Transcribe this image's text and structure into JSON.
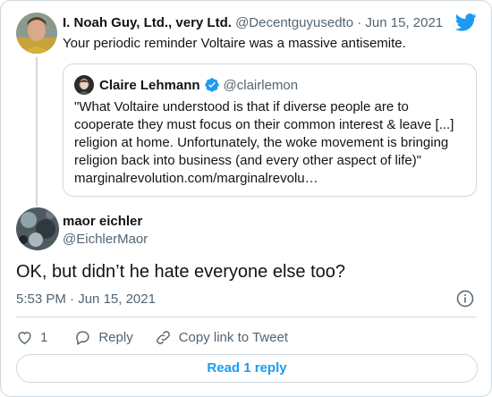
{
  "parent_tweet": {
    "name": "I. Noah Guy, Ltd., very Ltd.",
    "handle": "@Decentguyusedto",
    "separator": "·",
    "date": "Jun 15, 2021",
    "text": "Your periodic reminder Voltaire was a massive antisemite."
  },
  "quoted_tweet": {
    "name": "Claire Lehmann",
    "handle": "@clairlemon",
    "verified": true,
    "lines": [
      "\"What Voltaire understood is that if diverse people are to",
      "cooperate they must focus on their common interest &  leave [...]",
      "religion at home. Unfortunately, the woke movement is bringing",
      "religion back into business (and every other aspect of life)\"",
      "marginalrevolution.com/marginalrevolu…"
    ]
  },
  "main_tweet": {
    "name": "maor eichler",
    "handle": "@EichlerMaor",
    "text": "OK, but didn’t he hate everyone else too?",
    "time": "5:53 PM",
    "separator": "·",
    "date": "Jun 15, 2021"
  },
  "actions": {
    "like_count": "1",
    "reply_label": "Reply",
    "copy_link_label": "Copy link to Tweet"
  },
  "read_replies_label": "Read 1 reply",
  "colors": {
    "accent": "#1d9bf0",
    "text": "#0f1419",
    "muted": "#536471",
    "border": "#cfd9de"
  },
  "icons": [
    "twitter-bird-icon",
    "verified-badge-icon",
    "info-icon",
    "heart-icon",
    "reply-icon",
    "link-icon"
  ]
}
